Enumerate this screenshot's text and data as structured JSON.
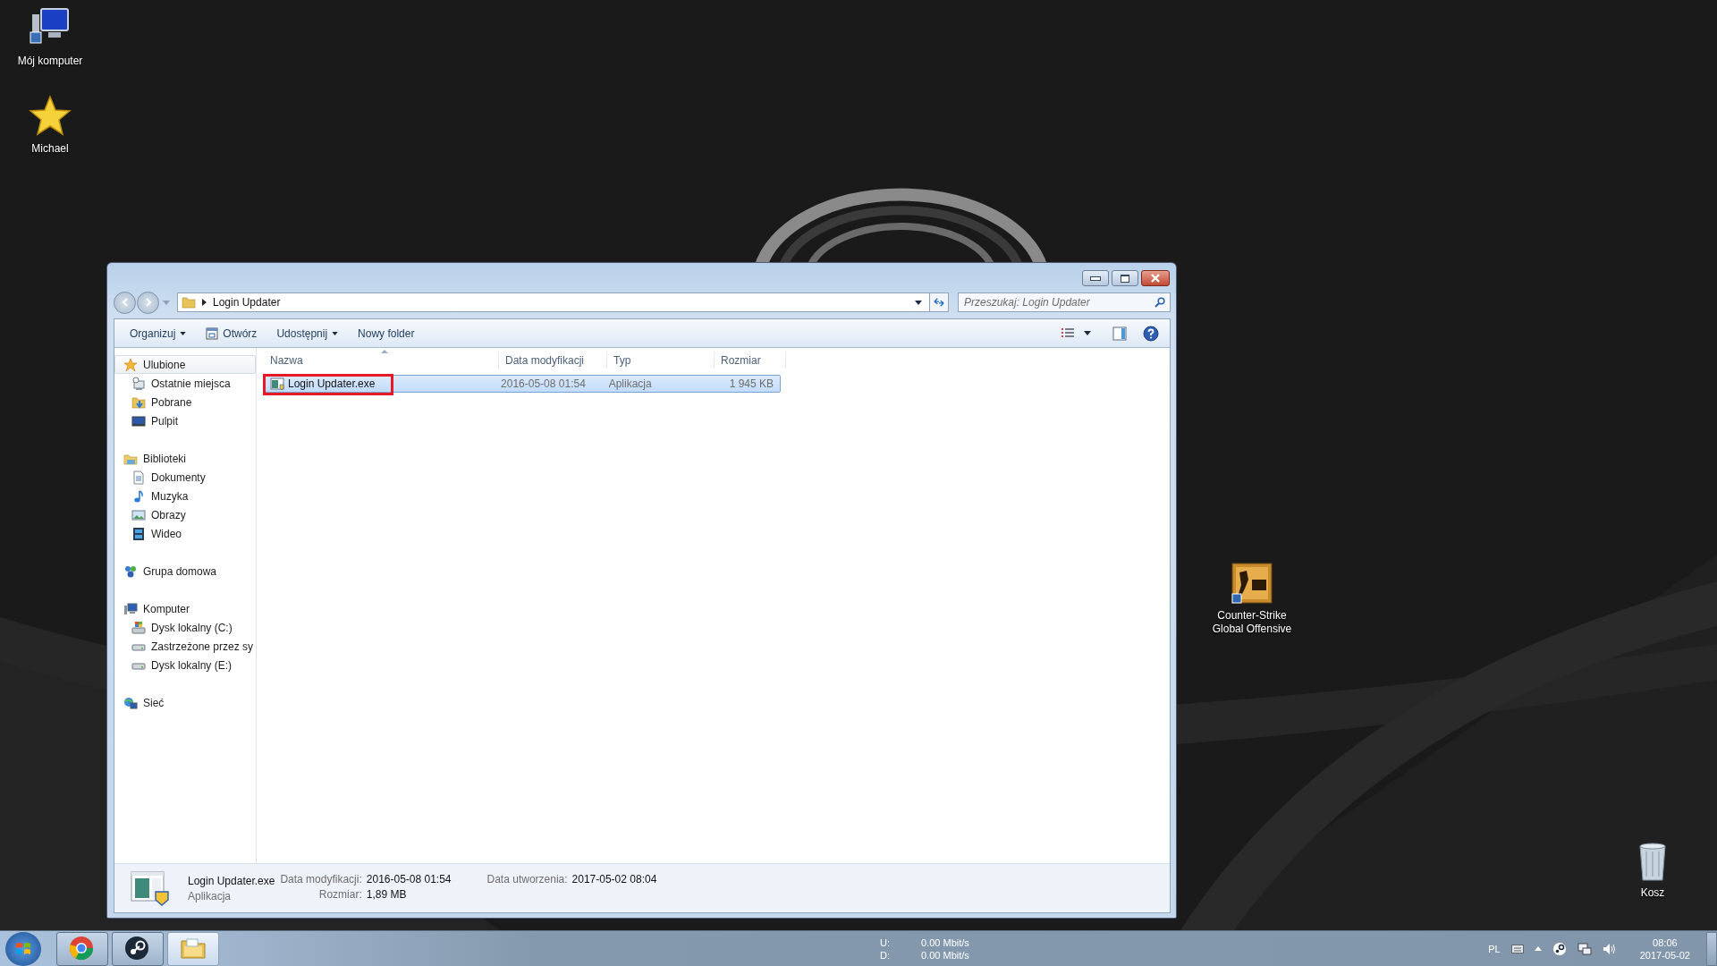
{
  "desktop": {
    "icons": [
      {
        "label": "Mój komputer",
        "kind": "computer"
      },
      {
        "label": "Michael",
        "kind": "star"
      },
      {
        "label": "Counter-Strike Global Offensive",
        "kind": "game"
      },
      {
        "label": "Kosz",
        "kind": "trash"
      }
    ]
  },
  "window": {
    "address": {
      "crumbs": [
        "Login Updater"
      ]
    },
    "search": {
      "placeholder": "Przeszukaj: Login Updater"
    },
    "toolbar": [
      {
        "label": "Organizuj",
        "kind": "menu"
      },
      {
        "label": "Otwórz",
        "kind": "open"
      },
      {
        "label": "Udostępnij",
        "kind": "menu"
      },
      {
        "label": "Nowy folder",
        "kind": "plain"
      }
    ],
    "sidebar": [
      {
        "label": "Ulubione",
        "kind": "star",
        "selected": true,
        "children": [
          {
            "label": "Ostatnie miejsca",
            "kind": "recent",
            "selected": false
          },
          {
            "label": "Pobrane",
            "kind": "downloads",
            "selected": false
          },
          {
            "label": "Pulpit",
            "kind": "desktop",
            "selected": false
          }
        ]
      },
      {
        "label": "Biblioteki",
        "kind": "library",
        "selected": false,
        "children": [
          {
            "label": "Dokumenty",
            "kind": "documents",
            "selected": false
          },
          {
            "label": "Muzyka",
            "kind": "music",
            "selected": false
          },
          {
            "label": "Obrazy",
            "kind": "pictures",
            "selected": false
          },
          {
            "label": "Wideo",
            "kind": "video",
            "selected": false
          }
        ]
      },
      {
        "label": "Grupa domowa",
        "kind": "homegroup",
        "selected": false
      },
      {
        "label": "Komputer",
        "kind": "computer",
        "selected": false,
        "children": [
          {
            "label": "Dysk lokalny (C:)",
            "kind": "system-drive",
            "selected": false
          },
          {
            "label": "Zastrzeżone przez sy",
            "kind": "drive",
            "selected": false
          },
          {
            "label": "Dysk lokalny (E:)",
            "kind": "drive",
            "selected": false
          }
        ]
      },
      {
        "label": "Sieć",
        "kind": "network",
        "selected": false
      }
    ],
    "columns": [
      {
        "label": "Nazwa",
        "sorted": true
      },
      {
        "label": "Data modyfikacji",
        "sorted": false
      },
      {
        "label": "Typ",
        "sorted": false
      },
      {
        "label": "Rozmiar",
        "sorted": false
      }
    ],
    "files": [
      {
        "name": "Login Updater.exe",
        "modified": "2016-05-08 01:54",
        "type": "Aplikacja",
        "size": "1 945 KB",
        "selected": true,
        "highlighted": true
      }
    ],
    "details": {
      "name": "Login Updater.exe",
      "type": "Aplikacja",
      "groups": [
        [
          {
            "label": "Data modyfikacji:",
            "value": "2016-05-08 01:54"
          },
          {
            "label": "Rozmiar:",
            "value": "1,89 MB"
          }
        ],
        [
          {
            "label": "Data utworzenia:",
            "value": "2017-05-02 08:04"
          }
        ]
      ]
    }
  },
  "taskbar": {
    "apps": [
      {
        "kind": "chrome",
        "active": false
      },
      {
        "kind": "steam",
        "active": false
      },
      {
        "kind": "explorer",
        "active": true
      }
    ],
    "meter": [
      {
        "label": "U:",
        "value": "0.00 Mbit/s"
      },
      {
        "label": "D:",
        "value": "0.00 Mbit/s"
      }
    ],
    "language": "PL",
    "time": "08:06",
    "date": "2017-05-02"
  }
}
